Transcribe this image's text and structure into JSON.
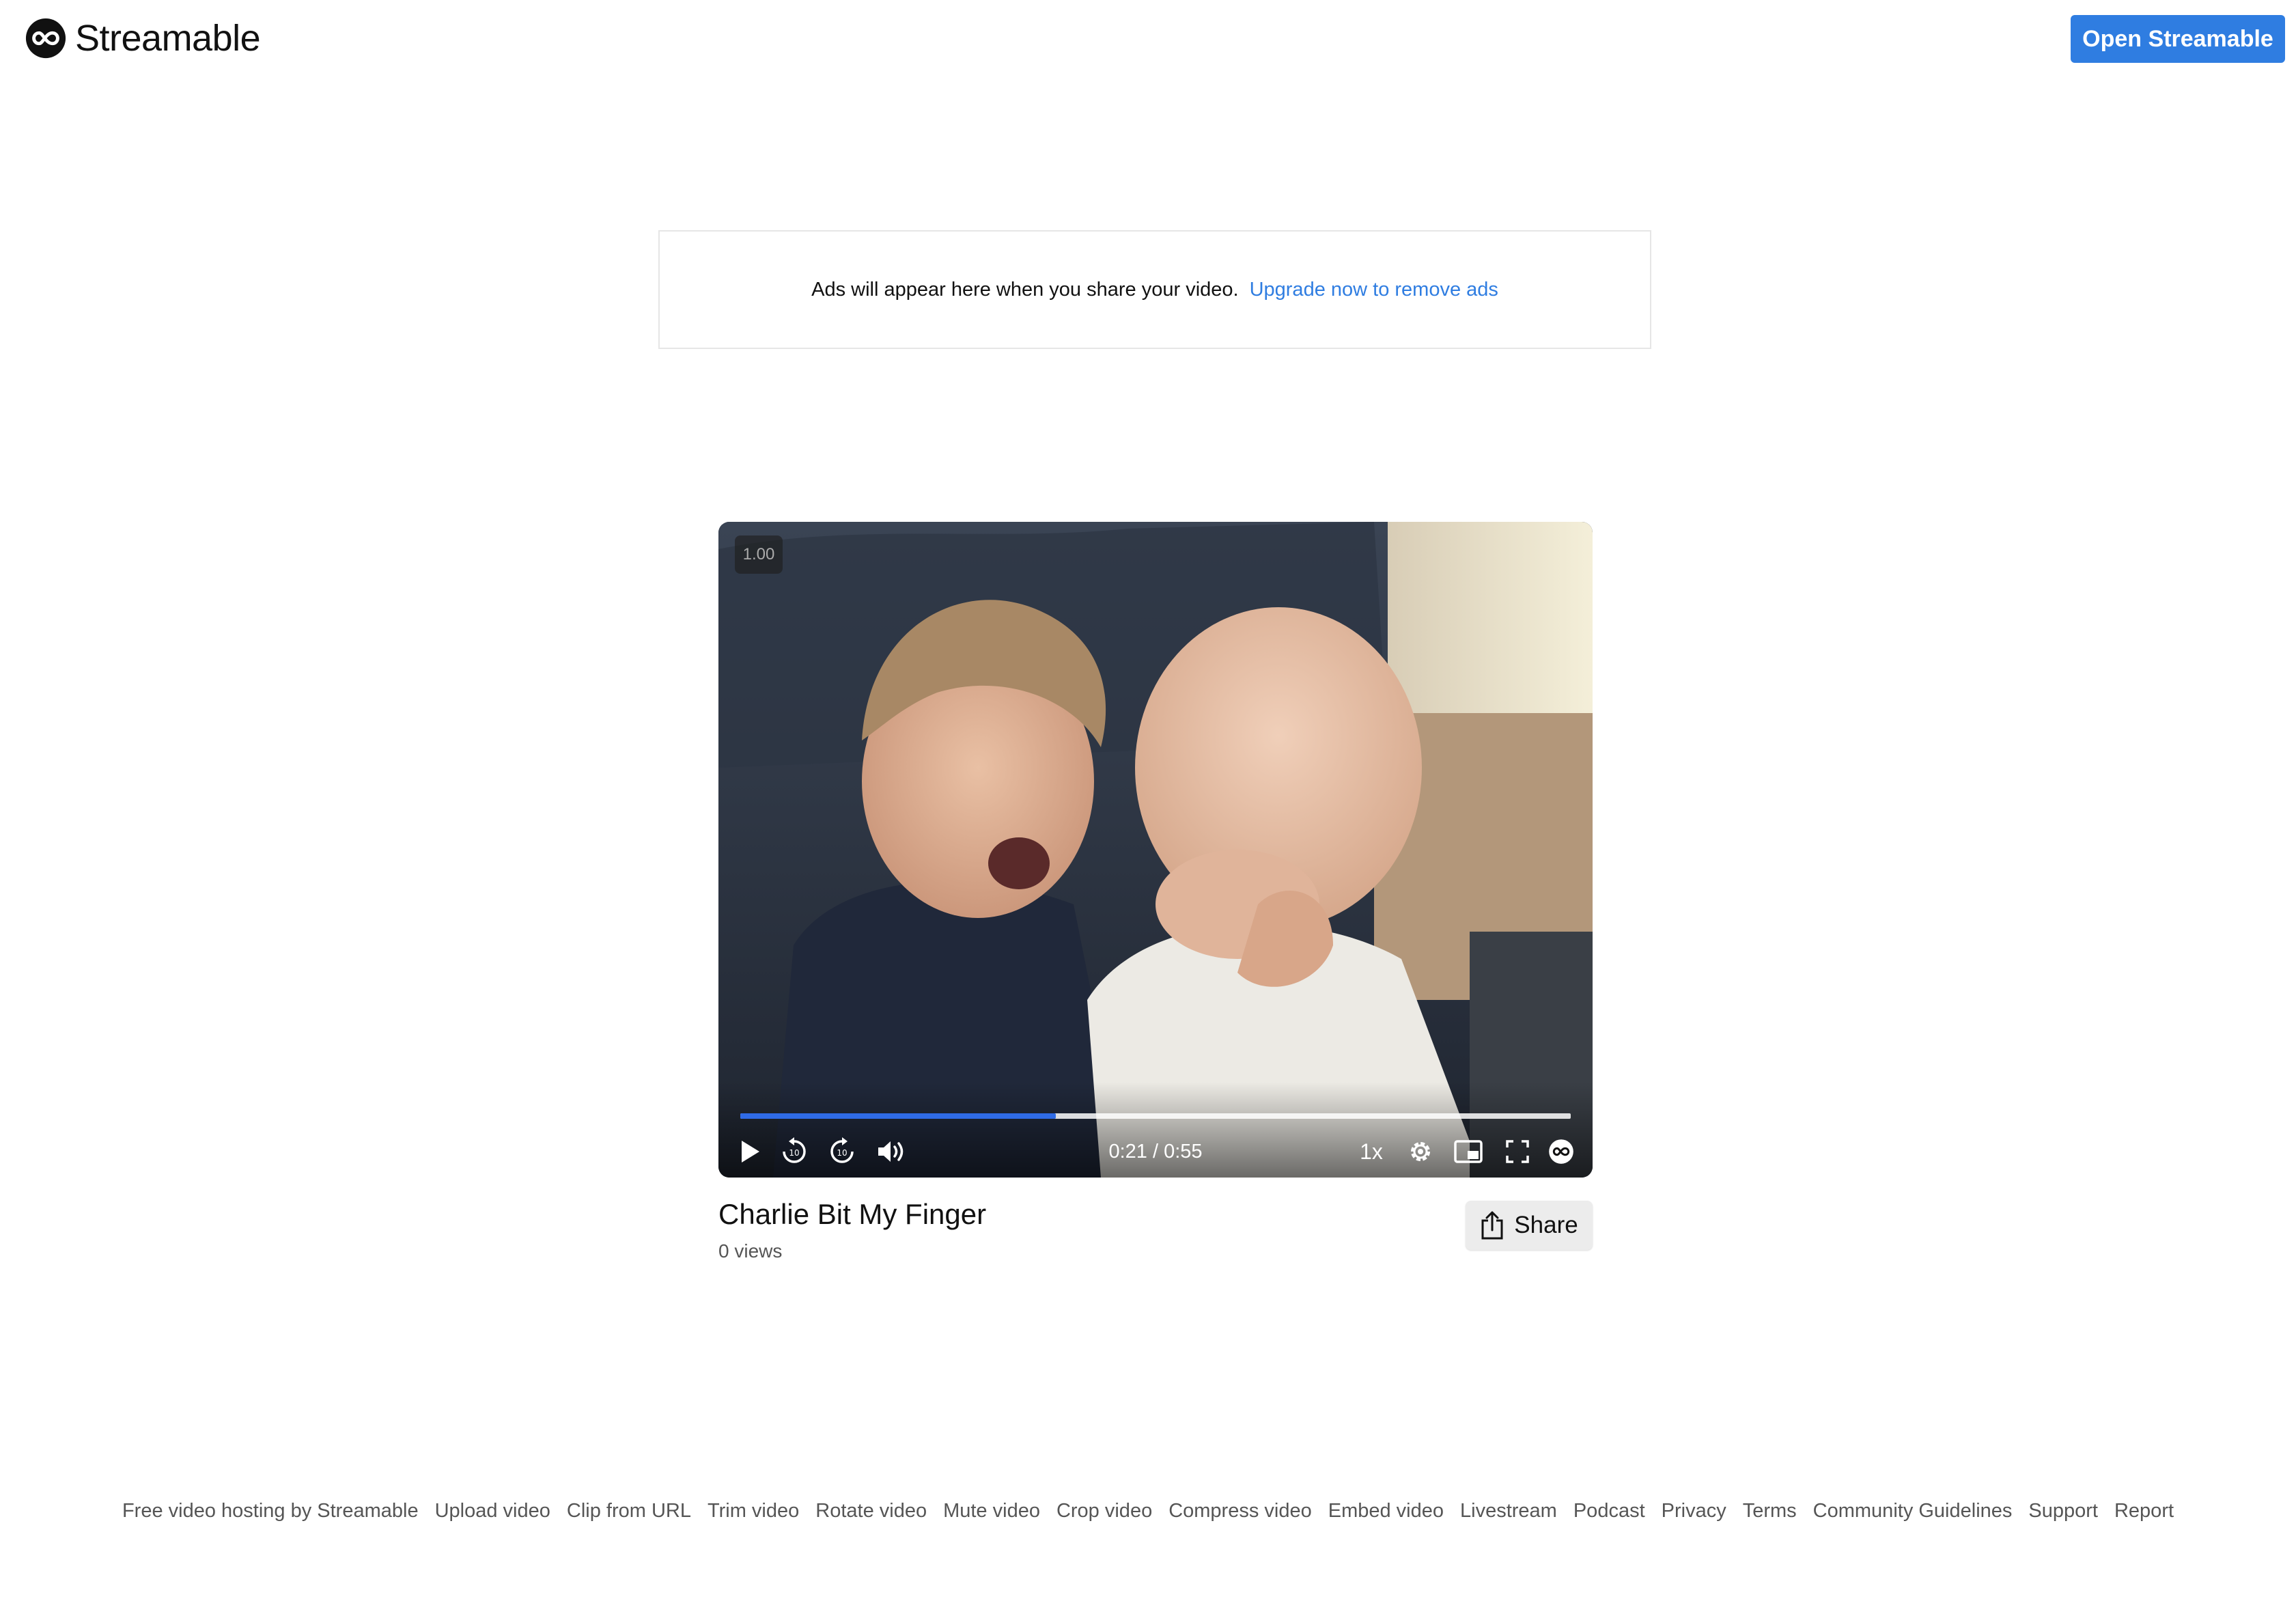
{
  "header": {
    "logo_text": "Streamable",
    "open_button": "Open Streamable"
  },
  "ad": {
    "text": "Ads will appear here when you share your video.",
    "link": "Upgrade now to remove ads"
  },
  "player": {
    "speed_overlay": "1.00",
    "progress": 0.38,
    "current_time": "0:21",
    "duration": "0:55",
    "time_display": "0:21 / 0:55",
    "rate_label": "1x",
    "accent_color": "#2f6be6",
    "icons": [
      "play-icon",
      "rewind-10-icon",
      "forward-10-icon",
      "volume-icon",
      "settings-gear-icon",
      "picture-in-picture-icon",
      "fullscreen-icon",
      "streamable-logo-icon"
    ]
  },
  "video": {
    "title": "Charlie Bit My Finger",
    "views": "0 views",
    "share_label": "Share"
  },
  "footer": {
    "links": [
      "Free video hosting by Streamable",
      "Upload video",
      "Clip from URL",
      "Trim video",
      "Rotate video",
      "Mute video",
      "Crop video",
      "Compress video",
      "Embed video",
      "Livestream",
      "Podcast",
      "Privacy",
      "Terms",
      "Community Guidelines",
      "Support",
      "Report"
    ]
  },
  "colors": {
    "brand_blue": "#2f7de1",
    "link_blue": "#2f7de1"
  }
}
